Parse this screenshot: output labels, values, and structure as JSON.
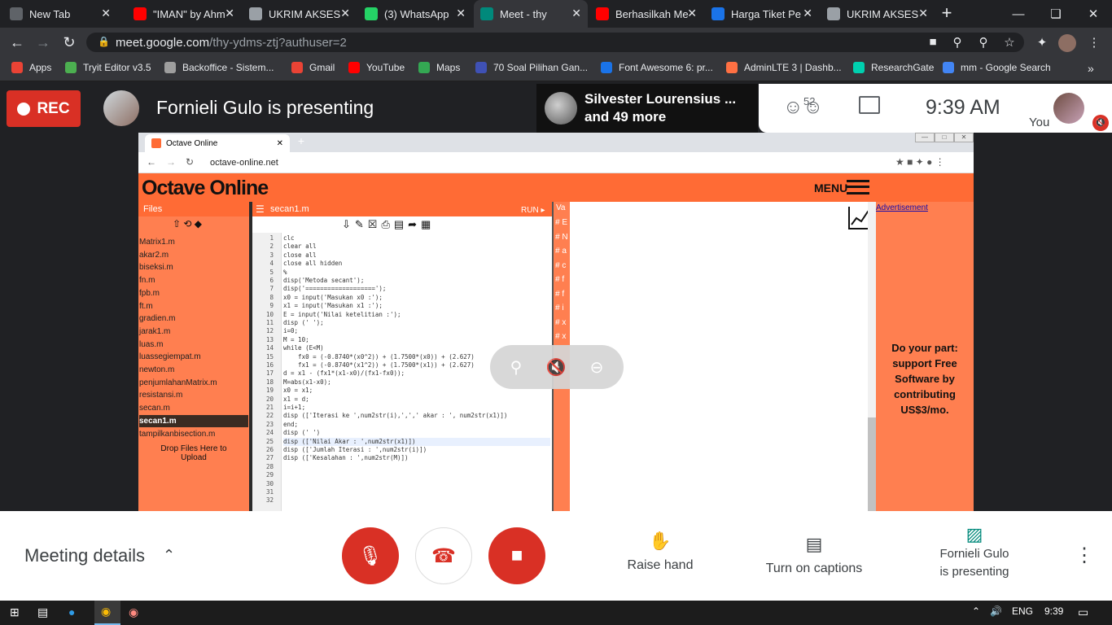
{
  "browser": {
    "tabs": [
      {
        "label": "New Tab",
        "icon": "blank-icon",
        "color": "#5f6368"
      },
      {
        "label": "\"IMAN\" by Ahm",
        "icon": "youtube-icon",
        "color": "#ff0000"
      },
      {
        "label": "UKRIM AKSES",
        "icon": "ukrim-icon",
        "color": "#9aa0a6"
      },
      {
        "label": "(3) WhatsApp",
        "icon": "whatsapp-icon",
        "color": "#25d366"
      },
      {
        "label": "Meet - thy",
        "icon": "meet-icon",
        "color": "#00897b",
        "active": true
      },
      {
        "label": "Berhasilkah Me",
        "icon": "youtube-icon",
        "color": "#ff0000"
      },
      {
        "label": "Harga Tiket Pe",
        "icon": "tiket-icon",
        "color": "#1a73e8"
      },
      {
        "label": "UKRIM AKSES",
        "icon": "ukrim-icon",
        "color": "#9aa0a6"
      }
    ],
    "url_host": "meet.google.com",
    "url_path": "/thy-ydms-ztj?authuser=2",
    "bookmarks": [
      {
        "label": "Apps",
        "color": "#ea4335"
      },
      {
        "label": "Tryit Editor v3.5",
        "color": "#4caf50"
      },
      {
        "label": "Backoffice - Sistem...",
        "color": "#9e9e9e"
      },
      {
        "label": "Gmail",
        "color": "#ea4335"
      },
      {
        "label": "YouTube",
        "color": "#ff0000"
      },
      {
        "label": "Maps",
        "color": "#34a853"
      },
      {
        "label": "70 Soal Pilihan Gan...",
        "color": "#3f51b5"
      },
      {
        "label": "Font Awesome 6: pr...",
        "color": "#1a73e8"
      },
      {
        "label": "AdminLTE 3 | Dashb...",
        "color": "#ff7043"
      },
      {
        "label": "ResearchGate",
        "color": "#00d0af"
      },
      {
        "label": "mm - Google Search",
        "color": "#4285f4"
      }
    ]
  },
  "meet": {
    "rec_label": "REC",
    "presenting_title": "Fornieli Gulo is presenting",
    "people_name": "Silvester Lourensius ...",
    "people_more": "and 49 more",
    "participants_count": "52",
    "time": "9:39  AM",
    "self_label": "You",
    "meeting_details": "Meeting details",
    "raise_hand": "Raise hand",
    "captions": "Turn on captions",
    "presenting_line1": "Fornieli Gulo",
    "presenting_line2": "is presenting"
  },
  "shared": {
    "tab_title": "Octave Online",
    "url": "octave-online.net",
    "logo": "Octave Online",
    "menu_label": "MENU",
    "files_header": "Files",
    "editor_file": "secan1.m",
    "run_label": "RUN ▸",
    "var_label": "Va",
    "files": [
      "Matrix1.m",
      "akar2.m",
      "biseksi.m",
      "fn.m",
      "fpb.m",
      "ft.m",
      "gradien.m",
      "jarak1.m",
      "luas.m",
      "luassegiempat.m",
      "newton.m",
      "penjumlahanMatrix.m",
      "resistansi.m",
      "secan.m",
      "secan1.m",
      "tampilkanbisection.m"
    ],
    "drop_text": "Drop Files Here to Upload",
    "ad_link": "Advertisement",
    "ad_text": "Do your part: support Free Software by contributing US$3/mo.",
    "code": [
      "clc",
      "clear all",
      "close all",
      "close all hidden",
      "%",
      "disp('Metoda secant');",
      "disp('===================');",
      "x0 = input('Masukan x0 :');",
      "x1 = input('Masukan x1 :');",
      "E = input('Nilai ketelitian :');",
      "disp (' ');",
      "i=0;",
      "M = 10;",
      "while (E<M)",
      "    fx0 = (-0.8740*(x0^2)) + (1.7500*(x0)) + (2.627)",
      "    fx1 = (-0.8740*(x1^2)) + (1.7500*(x1)) + (2.627)",
      "d = x1 - (fx1*(x1-x0)/(fx1-fx0));",
      "M=abs(x1-x0);",
      "x0 = x1;",
      "x1 = d;",
      "i=i+1;",
      "disp (['Iterasi ke ',num2str(i),',',' akar : ', num2str(x1)])",
      "end;",
      "disp (' ')",
      "disp (['Nilai Akar : ',num2str(x1)])",
      "disp (['Jumlah Iterasi : ',num2str(i)])",
      "disp (['Kesalahan : ',num2str(M)])",
      "",
      "",
      "",
      "",
      ""
    ],
    "out_marks": [
      "# E",
      "# N",
      "# a",
      "# c",
      "# f",
      "# f",
      "# i",
      "# x",
      "# x"
    ]
  },
  "taskbar": {
    "lang": "ENG",
    "time": "9:39"
  }
}
